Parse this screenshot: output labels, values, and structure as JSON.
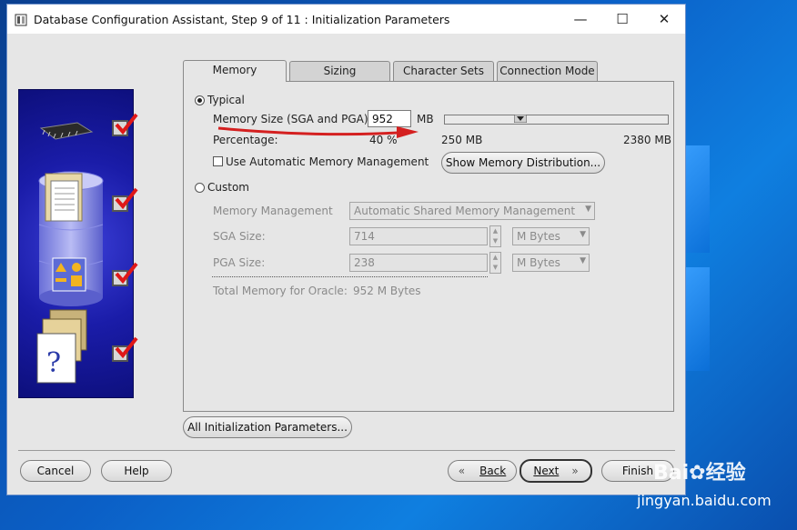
{
  "window": {
    "title": "Database Configuration Assistant, Step 9 of 11 : Initialization Parameters"
  },
  "tabs": [
    {
      "label": "Memory",
      "active": true
    },
    {
      "label": "Sizing",
      "active": false
    },
    {
      "label": "Character Sets",
      "active": false
    },
    {
      "label": "Connection Mode",
      "active": false
    }
  ],
  "memory": {
    "typical_label": "Typical",
    "typical_selected": true,
    "memory_size_label": "Memory Size (SGA and PGA):",
    "memory_size_value": "952",
    "memory_size_unit": "MB",
    "percentage_label": "Percentage:",
    "percentage_value": "40 %",
    "slider_min": "250 MB",
    "slider_max": "2380 MB",
    "auto_mem_label": "Use Automatic Memory Management",
    "show_distribution_button": "Show Memory Distribution...",
    "custom_label": "Custom",
    "custom_selected": false,
    "memory_management_label": "Memory Management",
    "memory_management_value": "Automatic Shared Memory Management",
    "sga_label": "SGA Size:",
    "sga_value": "714",
    "sga_unit": "M Bytes",
    "pga_label": "PGA Size:",
    "pga_value": "238",
    "pga_unit": "M Bytes",
    "total_memory_label": "Total Memory for Oracle:",
    "total_memory_value": "952 M Bytes"
  },
  "buttons": {
    "all_params": "All Initialization Parameters...",
    "cancel": "Cancel",
    "help": "Help",
    "back": "Back",
    "next": "Next",
    "finish": "Finish"
  },
  "colors": {
    "annotation_arrow": "#d42020",
    "side_panel": "#1a1ca8"
  },
  "watermark": {
    "brand": "Bai",
    "brand2": "经验",
    "url": "jingyan.baidu.com"
  },
  "icons": [
    "database-icon",
    "minimize-icon",
    "maximize-icon",
    "close-icon",
    "chip-icon",
    "folder-icon",
    "database-drum-icon",
    "shapes-icon",
    "question-document-icon",
    "checkmark-icon",
    "chevron-left-icon",
    "chevron-right-icon"
  ]
}
